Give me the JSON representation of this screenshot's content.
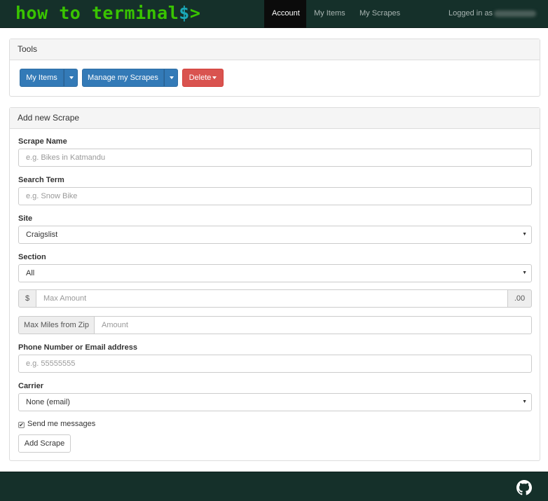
{
  "navbar": {
    "brand_text": "how to terminal",
    "brand_dollar": "$",
    "brand_gt": ">",
    "items": [
      {
        "label": "Account",
        "active": true
      },
      {
        "label": "My Items",
        "active": false
      },
      {
        "label": "My Scrapes",
        "active": false
      }
    ],
    "logged_in_label": "Logged in as"
  },
  "tools": {
    "title": "Tools",
    "buttons": {
      "my_items": "My Items",
      "manage_scrapes": "Manage my Scrapes",
      "delete": "Delete"
    }
  },
  "add_scrape": {
    "title": "Add new Scrape",
    "scrape_name": {
      "label": "Scrape Name",
      "placeholder": "e.g. Bikes in Katmandu"
    },
    "search_term": {
      "label": "Search Term",
      "placeholder": "e.g. Snow Bike"
    },
    "site": {
      "label": "Site",
      "selected": "Craigslist"
    },
    "section": {
      "label": "Section",
      "selected": "All"
    },
    "max_amount": {
      "prefix": "$",
      "placeholder": "Max Amount",
      "suffix": ".00"
    },
    "max_miles": {
      "addon": "Max Miles from Zip",
      "placeholder": "Amount"
    },
    "contact": {
      "label": "Phone Number or Email address",
      "placeholder": "e.g. 55555555"
    },
    "carrier": {
      "label": "Carrier",
      "selected": "None (email)"
    },
    "send_messages": {
      "label": "Send me messages",
      "checked": true
    },
    "submit_label": "Add Scrape"
  },
  "colors": {
    "navbar_bg": "#15302a",
    "brand_green": "#39c400",
    "brand_cyan": "#1aa8b8",
    "primary": "#337ab7",
    "danger": "#d9534f"
  },
  "icons": {
    "footer": "github-icon",
    "dropdown": "caret-down-icon",
    "select": "select-arrow-icon",
    "checkbox": "checkmark-icon"
  }
}
